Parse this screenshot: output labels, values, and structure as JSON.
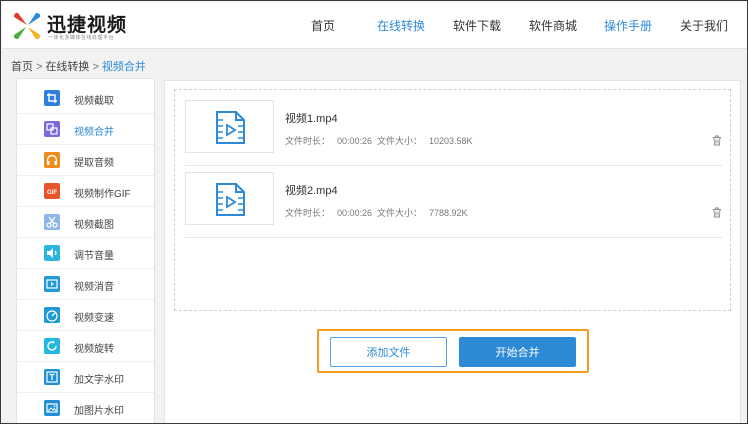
{
  "brand": {
    "title": "迅捷视频",
    "subtitle": "一体化多媒体在线处理平台",
    "colors": [
      "#e23b2e",
      "#2d8ad6",
      "#4cae3a",
      "#f2b21a"
    ]
  },
  "nav": {
    "items": [
      {
        "label": "首页",
        "active": false
      },
      {
        "label": "在线转换",
        "active": true
      },
      {
        "label": "软件下载",
        "active": false
      },
      {
        "label": "软件商城",
        "active": false
      },
      {
        "label": "操作手册",
        "active": true
      },
      {
        "label": "关于我们",
        "active": false
      }
    ]
  },
  "breadcrumb": {
    "items": [
      "首页",
      "在线转换",
      "视频合并"
    ],
    "separator": ">"
  },
  "sidebar": {
    "items": [
      {
        "label": "视频截取",
        "icon": "crop-icon",
        "color": "#2f7ee0"
      },
      {
        "label": "视频合并",
        "icon": "merge-icon",
        "color": "#7b68d9",
        "active": true
      },
      {
        "label": "提取音频",
        "icon": "headphones-icon",
        "color": "#f08a1c"
      },
      {
        "label": "视频制作GIF",
        "icon": "gif-icon",
        "color": "#e8542a"
      },
      {
        "label": "视频截图",
        "icon": "scissors-icon",
        "color": "#8fb6e8"
      },
      {
        "label": "调节音量",
        "icon": "volume-icon",
        "color": "#2bb6e0"
      },
      {
        "label": "视频消音",
        "icon": "mute-video-icon",
        "color": "#1f9ad6"
      },
      {
        "label": "视频变速",
        "icon": "speedometer-icon",
        "color": "#1f9ad6"
      },
      {
        "label": "视频旋转",
        "icon": "rotate-icon",
        "color": "#22b8e0"
      },
      {
        "label": "加文字水印",
        "icon": "text-watermark-icon",
        "color": "#1f8fd6"
      },
      {
        "label": "加图片水印",
        "icon": "image-watermark-icon",
        "color": "#1f8fd6"
      }
    ]
  },
  "files": {
    "duration_label": "文件时长：",
    "size_label": "文件大小：",
    "items": [
      {
        "name": "视频1.mp4",
        "duration": "00:00:26",
        "size": "10203.58K"
      },
      {
        "name": "视频2.mp4",
        "duration": "00:00:26",
        "size": "7788.92K"
      }
    ]
  },
  "actions": {
    "add_label": "添加文件",
    "start_label": "开始合并"
  },
  "colors": {
    "accent": "#2d8ad6",
    "highlight": "#f29b1f"
  }
}
